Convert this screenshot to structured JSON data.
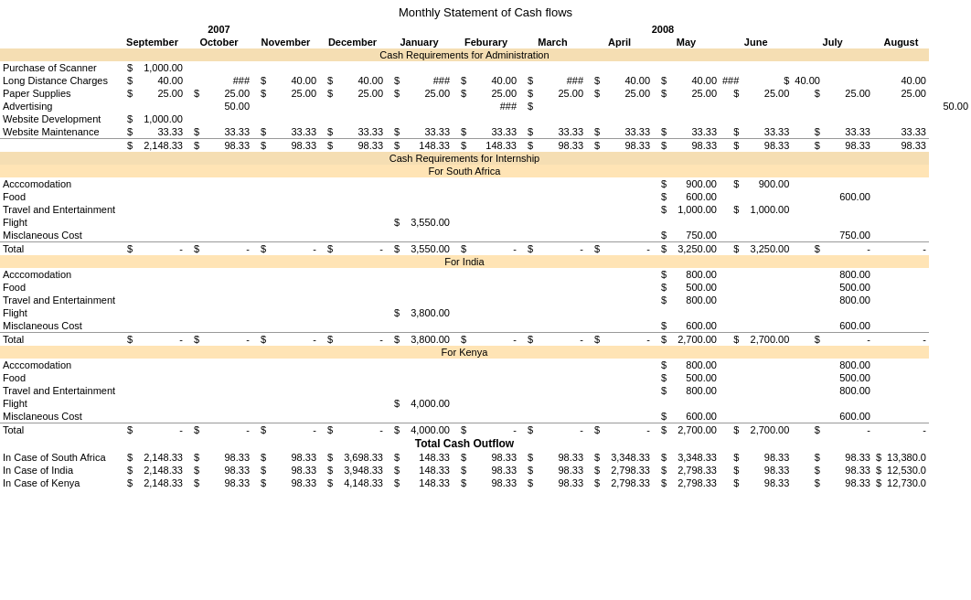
{
  "title": "Monthly Statement of Cash flows",
  "years": {
    "y2007": "2007",
    "y2008": "2008"
  },
  "months": [
    "September",
    "October",
    "November",
    "December",
    "January",
    "Feburary",
    "March",
    "April",
    "May",
    "June",
    "July",
    "August"
  ],
  "sections": {
    "admin": "Cash Requirements for Administration",
    "internship": "Cash Requirements for Internship",
    "southAfrica": "For South Africa",
    "india": "For India",
    "kenya": "For Kenya",
    "totalOutflow": "Total Cash Outflow"
  },
  "adminItems": [
    {
      "label": "Purchase of Scanner",
      "vals": [
        "$",
        "1,000.00",
        "",
        "",
        "",
        "",
        "",
        "",
        "",
        "",
        "",
        "",
        "",
        "",
        "",
        "",
        "",
        "",
        "",
        "",
        "",
        "",
        "",
        "",
        ""
      ]
    },
    {
      "label": "Long Distance Charges",
      "vals": [
        "$",
        "40.00",
        "",
        "###",
        "$",
        "40.00",
        "$",
        "40.00",
        "$",
        "###",
        "$",
        "40.00",
        "$",
        "###",
        "$",
        "40.00",
        "$",
        "40.00",
        "###",
        "$",
        "40.00"
      ]
    },
    {
      "label": "Paper Supplies",
      "vals": [
        "$",
        "25.00",
        "$",
        "25.00",
        "$",
        "25.00",
        "$",
        "25.00",
        "$",
        "25.00",
        "$",
        "25.00",
        "$",
        "25.00",
        "$",
        "25.00",
        "$",
        "25.00",
        "$",
        "25.00",
        "$",
        "25.00",
        "25.00"
      ]
    },
    {
      "label": "Advertising",
      "vals": [
        "",
        "",
        "",
        "50.00",
        "",
        "",
        "",
        "###",
        "$",
        "",
        "",
        "50.00",
        "",
        "",
        "",
        "",
        "",
        "",
        "",
        "",
        "",
        "",
        "",
        "",
        ""
      ]
    },
    {
      "label": "Website Development",
      "vals": [
        "$",
        "1,000.00",
        "",
        "",
        "",
        "",
        "",
        "",
        "",
        "",
        "",
        "",
        "",
        "",
        "",
        "",
        "",
        "",
        "",
        "",
        "",
        "",
        "",
        "",
        ""
      ]
    },
    {
      "label": "Website Maintenance",
      "vals": [
        "$",
        "33.33",
        "$",
        "33.33",
        "$",
        "33.33",
        "$",
        "33.33",
        "$",
        "33.33",
        "$",
        "33.33",
        "$",
        "33.33",
        "$",
        "33.33",
        "$",
        "33.33",
        "$",
        "33.33",
        "$",
        "33.33",
        "33.33"
      ]
    }
  ],
  "adminTotal": {
    "label": "$",
    "vals": [
      "$",
      "2,148.33",
      "$",
      "98.33",
      "$",
      "98.33",
      "$",
      "98.33",
      "$",
      "148.33",
      "$",
      "148.33",
      "$",
      "98.33",
      "$",
      "98.33",
      "$",
      "98.33",
      "$",
      "98.33",
      "$",
      "98.33",
      "98.33"
    ]
  },
  "saItems": [
    {
      "label": "Acccomodation",
      "vals": [
        "$",
        "900.00",
        "$",
        "900.00"
      ]
    },
    {
      "label": "Food",
      "vals": [
        "$",
        "600.00",
        "",
        "600.00"
      ]
    },
    {
      "label": "Travel and Entertainment",
      "vals": [
        "$",
        "1,000.00",
        "$",
        "1,000.00"
      ]
    },
    {
      "label": "Flight",
      "vals": [
        "$",
        "3,550.00"
      ]
    },
    {
      "label": "Misclaneous Cost",
      "vals": [
        "$",
        "750.00",
        "",
        "750.00"
      ]
    }
  ],
  "saTotal": {
    "vals": [
      "$",
      "3,550.00",
      "$",
      "",
      "$",
      "",
      "$",
      "3,250.00",
      "$",
      "3,250.00",
      "$",
      "-",
      "$",
      "-"
    ]
  },
  "indiaItems": [
    {
      "label": "Acccomodation",
      "vals": [
        "$",
        "800.00",
        "",
        "800.00"
      ]
    },
    {
      "label": "Food",
      "vals": [
        "$",
        "500.00",
        "",
        "500.00"
      ]
    },
    {
      "label": "Travel and Entertainment",
      "vals": [
        "$",
        "800.00",
        "",
        "800.00"
      ]
    },
    {
      "label": "Flight",
      "vals": [
        "$",
        "3,800.00"
      ]
    },
    {
      "label": "Misclaneous Cost",
      "vals": [
        "$",
        "600.00",
        "",
        "600.00"
      ]
    }
  ],
  "indiaTotal": {
    "vals": [
      "$",
      "3,800.00",
      "$",
      "",
      "$",
      "2,700.00",
      "$",
      "2,700.00",
      "$",
      "-",
      "$",
      "-"
    ]
  },
  "kenyaItems": [
    {
      "label": "Acccomodation",
      "vals": [
        "$",
        "800.00",
        "",
        "800.00"
      ]
    },
    {
      "label": "Food",
      "vals": [
        "$",
        "500.00",
        "",
        "500.00"
      ]
    },
    {
      "label": "Travel and Entertainment",
      "vals": [
        "$",
        "800.00",
        "",
        "800.00"
      ]
    },
    {
      "label": "Flight",
      "vals": [
        "$",
        "4,000.00"
      ]
    },
    {
      "label": "Misclaneous Cost",
      "vals": [
        "$",
        "600.00",
        "",
        "600.00"
      ]
    }
  ],
  "kenyaTotal": {
    "vals": [
      "$",
      "4,000.00",
      "$",
      "",
      "$",
      "2,700.00",
      "$",
      "2,700.00",
      "$",
      "-",
      "$",
      "-"
    ]
  },
  "outflowRows": [
    {
      "label": "In Case of South Africa",
      "vals": [
        "$",
        "2,148.33",
        "$",
        "98.33",
        "$",
        "98.33",
        "$",
        "3,698.33",
        "$",
        "148.33",
        "$",
        "98.33",
        "$",
        "98.33",
        "$",
        "3,348.33",
        "$",
        "3,348.33",
        "$",
        "98.33",
        "$",
        "98.33",
        "$",
        "13,380.0"
      ]
    },
    {
      "label": "In Case of India",
      "vals": [
        "$",
        "2,148.33",
        "$",
        "98.33",
        "$",
        "98.33",
        "$",
        "3,948.33",
        "$",
        "148.33",
        "$",
        "98.33",
        "$",
        "98.33",
        "$",
        "2,798.33",
        "$",
        "2,798.33",
        "$",
        "98.33",
        "$",
        "98.33",
        "$",
        "12,530.0"
      ]
    },
    {
      "label": "In Case of Kenya",
      "vals": [
        "$",
        "2,148.33",
        "$",
        "98.33",
        "$",
        "98.33",
        "$",
        "4,148.33",
        "$",
        "148.33",
        "$",
        "98.33",
        "$",
        "98.33",
        "$",
        "2,798.33",
        "$",
        "2,798.33",
        "$",
        "98.33",
        "$",
        "98.33",
        "$",
        "12,730.0"
      ]
    }
  ]
}
